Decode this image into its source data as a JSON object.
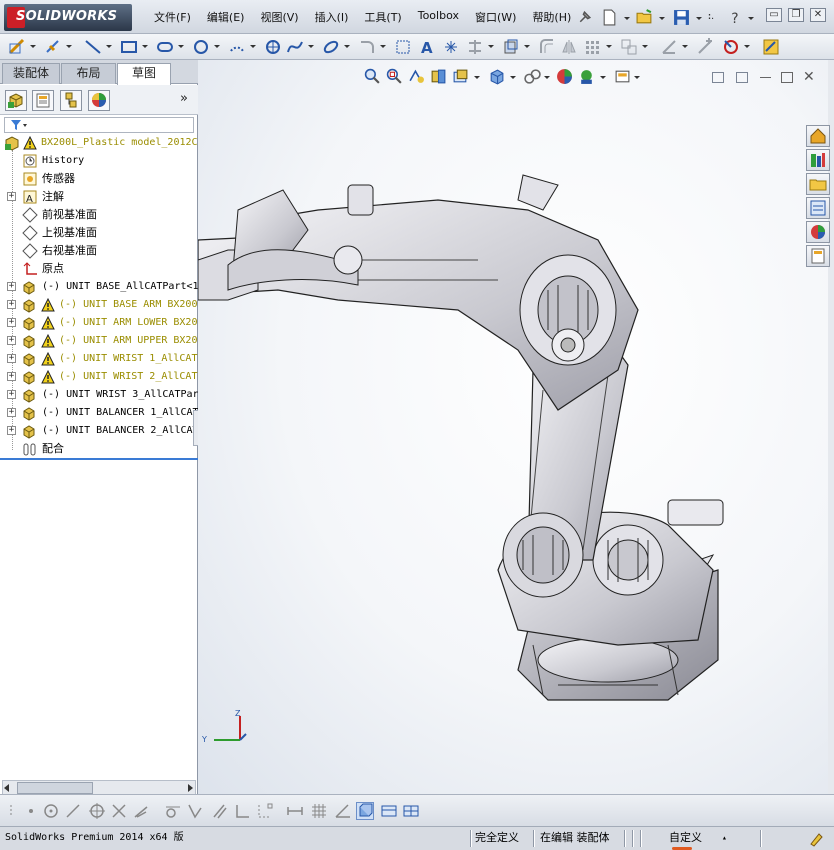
{
  "app": {
    "logo_text": "SOLIDWORKS",
    "brand_color": "#cc1f27"
  },
  "menu": {
    "items": [
      "文件(F)",
      "编辑(E)",
      "视图(V)",
      "插入(I)",
      "工具(T)",
      "Toolbox",
      "窗口(W)",
      "帮助(H)"
    ],
    "overflow": "»"
  },
  "window_controls": {
    "minimize": "▭",
    "restore": "❐",
    "close": "✕"
  },
  "sidebar": {
    "tabs": [
      "装配体",
      "布局",
      "草图"
    ],
    "active_tab": "草图",
    "pane_icons": [
      "feature-manager-icon",
      "property-manager-icon",
      "configuration-manager-icon",
      "display-manager-icon"
    ],
    "pane_overflow": "»",
    "filter_icon": "filter-icon",
    "tree": [
      {
        "label": "BX200L_Plastic model_2012C",
        "icon": "assembly-icon",
        "warning": true,
        "expander": "",
        "indent": 0
      },
      {
        "label": "History",
        "icon": "history-icon",
        "warning": false,
        "expander": "",
        "indent": 1
      },
      {
        "label": "传感器",
        "icon": "sensor-icon",
        "warning": false,
        "expander": "",
        "indent": 1
      },
      {
        "label": "注解",
        "icon": "annotation-icon",
        "warning": false,
        "expander": "+",
        "indent": 1
      },
      {
        "label": "前视基准面",
        "icon": "plane-icon",
        "warning": false,
        "expander": "",
        "indent": 1
      },
      {
        "label": "上视基准面",
        "icon": "plane-icon",
        "warning": false,
        "expander": "",
        "indent": 1
      },
      {
        "label": "右视基准面",
        "icon": "plane-icon",
        "warning": false,
        "expander": "",
        "indent": 1
      },
      {
        "label": "原点",
        "icon": "origin-icon",
        "warning": false,
        "expander": "",
        "indent": 1
      },
      {
        "label": "(-) UNIT BASE_AllCATPart<1",
        "icon": "part-icon",
        "warning": false,
        "expander": "+",
        "indent": 1
      },
      {
        "label": "(-) UNIT BASE ARM BX200",
        "icon": "part-icon",
        "warning": true,
        "expander": "+",
        "indent": 1
      },
      {
        "label": "(-) UNIT ARM LOWER BX20",
        "icon": "part-icon",
        "warning": true,
        "expander": "+",
        "indent": 1
      },
      {
        "label": "(-) UNIT ARM UPPER BX20",
        "icon": "part-icon",
        "warning": true,
        "expander": "+",
        "indent": 1
      },
      {
        "label": "(-) UNIT WRIST 1_AllCAT",
        "icon": "part-icon",
        "warning": true,
        "expander": "+",
        "indent": 1
      },
      {
        "label": "(-) UNIT WRIST 2_AllCAT",
        "icon": "part-icon",
        "warning": true,
        "expander": "+",
        "indent": 1
      },
      {
        "label": "(-) UNIT WRIST 3_AllCATPar",
        "icon": "part-icon",
        "warning": false,
        "expander": "+",
        "indent": 1
      },
      {
        "label": "(-) UNIT BALANCER 1_AllCAT",
        "icon": "part-icon",
        "warning": false,
        "expander": "+",
        "indent": 1
      },
      {
        "label": "(-) UNIT BALANCER 2_AllCAT",
        "icon": "part-icon",
        "warning": false,
        "expander": "+",
        "indent": 1
      },
      {
        "label": "配合",
        "icon": "mates-icon",
        "warning": false,
        "expander": "",
        "indent": 1
      }
    ]
  },
  "viewport": {
    "triad": {
      "y_label": "Y",
      "z_label": "Z"
    }
  },
  "statusbar": {
    "product": "SolidWorks Premium 2014 x64 版",
    "definition": "完全定义",
    "edit_mode": "在编辑 装配体",
    "units": "自定义",
    "units_caret": "▴"
  }
}
